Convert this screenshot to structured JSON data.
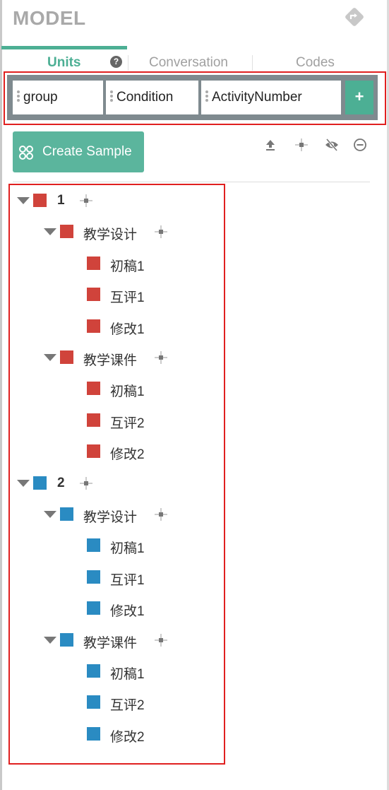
{
  "panel": {
    "title": "MODEL",
    "share_icon": "directions-diamond-icon"
  },
  "tabs": [
    {
      "label": "Units",
      "active": true
    },
    {
      "label": "Conversation",
      "active": false
    },
    {
      "label": "Codes",
      "active": false
    }
  ],
  "help_icon_label": "?",
  "chips": [
    {
      "label": "group"
    },
    {
      "label": "Condition"
    },
    {
      "label": "ActivityNumber"
    }
  ],
  "add_chip_label": "+",
  "create_sample_label": "Create Sample",
  "toolbar_icons": [
    "upload-icon",
    "center-cross-icon",
    "hide-eye-icon",
    "remove-circle-icon"
  ],
  "colors": {
    "accent": "#4caf94",
    "group1": "#d0433b",
    "group2": "#2a8bc2",
    "highlight": "#e02020"
  },
  "tree": [
    {
      "label": "1",
      "color": "#d0433b",
      "children": [
        {
          "label": "教学设计",
          "children": [
            "初稿1",
            "互评1",
            "修改1"
          ]
        },
        {
          "label": "教学课件",
          "children": [
            "初稿1",
            "互评2",
            "修改2"
          ]
        }
      ]
    },
    {
      "label": "2",
      "color": "#2a8bc2",
      "children": [
        {
          "label": "教学设计",
          "children": [
            "初稿1",
            "互评1",
            "修改1"
          ]
        },
        {
          "label": "教学课件",
          "children": [
            "初稿1",
            "互评2",
            "修改2"
          ]
        }
      ]
    }
  ]
}
